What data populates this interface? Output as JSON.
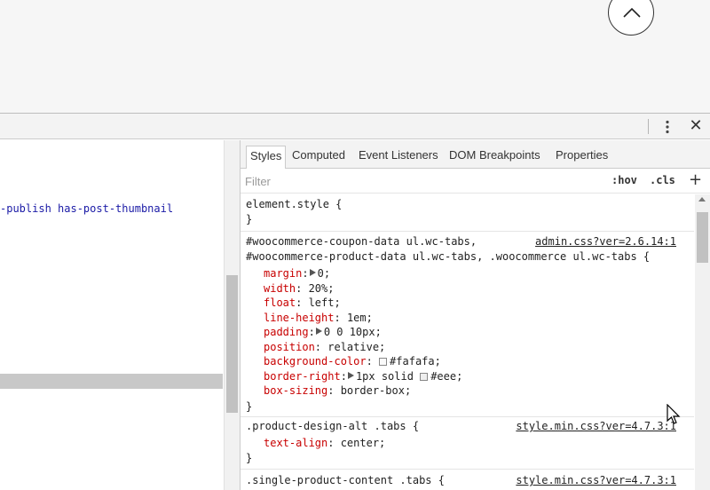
{
  "devtools": {
    "toolbar": {
      "kebab_icon": "kebab-menu-icon",
      "close_icon": "close-icon",
      "close_glyph": "✕"
    },
    "elements_panel": {
      "visible_line": "-publish has-post-thumbnail"
    },
    "styles_pane": {
      "tabs": [
        {
          "label": "Styles",
          "active": true
        },
        {
          "label": "Computed",
          "active": false
        },
        {
          "label": "Event Listeners",
          "active": false
        },
        {
          "label": "DOM Breakpoints",
          "active": false
        },
        {
          "label": "Properties",
          "active": false
        }
      ],
      "filter": {
        "placeholder": "Filter",
        "value": ""
      },
      "hov_label": ":hov",
      "cls_label": ".cls",
      "new_rule_label": "+",
      "rules": [
        {
          "selector": "element.style {",
          "close": "}",
          "properties": []
        },
        {
          "selector_lines": [
            "#woocommerce-coupon-data ul.wc-tabs,",
            "#woocommerce-product-data ul.wc-tabs, .woocommerce ul.wc-tabs {"
          ],
          "source": "admin.css?ver=2.6.14:1",
          "close": "}",
          "properties": [
            {
              "name": "margin",
              "value": "0;",
              "expandable": true,
              "swatch": null
            },
            {
              "name": "width",
              "value": "20%;",
              "expandable": false,
              "swatch": null
            },
            {
              "name": "float",
              "value": "left;",
              "expandable": false,
              "swatch": null
            },
            {
              "name": "line-height",
              "value": "1em;",
              "expandable": false,
              "swatch": null
            },
            {
              "name": "padding",
              "value": "0 0 10px;",
              "expandable": true,
              "swatch": null
            },
            {
              "name": "position",
              "value": "relative;",
              "expandable": false,
              "swatch": null
            },
            {
              "name": "background-color",
              "value": "#fafafa;",
              "expandable": false,
              "swatch": "#fafafa"
            },
            {
              "name": "border-right",
              "value": "1px solid ",
              "value_after": "#eee;",
              "expandable": true,
              "swatch": "#eeeeee"
            },
            {
              "name": "box-sizing",
              "value": "border-box;",
              "expandable": false,
              "swatch": null
            }
          ]
        },
        {
          "selector": ".product-design-alt .tabs {",
          "source": "style.min.css?ver=4.7.3:1",
          "close": "}",
          "properties": [
            {
              "name": "text-align",
              "value": "center;",
              "expandable": false,
              "swatch": null
            }
          ]
        },
        {
          "selector": ".single-product-content .tabs {",
          "source": "style.min.css?ver=4.7.3:1"
        }
      ]
    }
  },
  "colors": {
    "property_name": "#c80000",
    "dom_text": "#1a1aa6",
    "toolbar_bg": "#f3f3f3"
  }
}
